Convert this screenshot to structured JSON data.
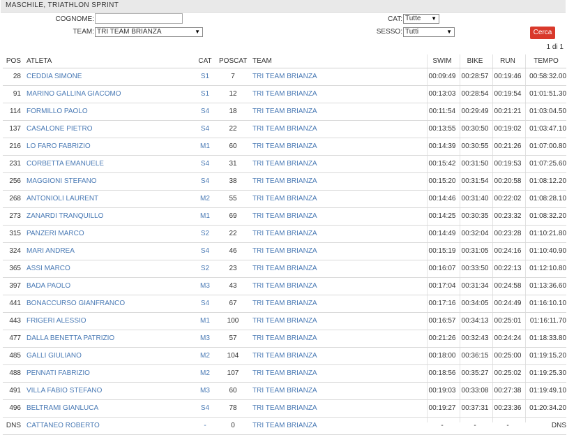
{
  "title": "MASCHILE, TRIATHLON SPRINT",
  "filters": {
    "cognome_label": "COGNOME:",
    "cognome_value": "",
    "team_label": "TEAM:",
    "team_value": "TRI TEAM BRIANZA",
    "cat_label": "CAT:",
    "cat_value": "Tutte",
    "sesso_label": "SESSO:",
    "sesso_value": "Tutti",
    "search_button": "Cerca"
  },
  "pager": "1 di 1",
  "columns": {
    "pos": "POS",
    "atleta": "ATLETA",
    "cat": "CAT",
    "poscat": "POSCAT",
    "team": "TEAM",
    "swim": "SWIM",
    "bike": "BIKE",
    "run": "RUN",
    "tempo": "TEMPO"
  },
  "rows": [
    {
      "pos": "28",
      "atleta": "CEDDIA SIMONE",
      "cat": "S1",
      "poscat": "7",
      "team": "TRI TEAM BRIANZA",
      "swim": "00:09:49",
      "bike": "00:28:57",
      "run": "00:19:46",
      "tempo": "00:58:32.00"
    },
    {
      "pos": "91",
      "atleta": "MARINO GALLINA GIACOMO",
      "cat": "S1",
      "poscat": "12",
      "team": "TRI TEAM BRIANZA",
      "swim": "00:13:03",
      "bike": "00:28:54",
      "run": "00:19:54",
      "tempo": "01:01:51.30"
    },
    {
      "pos": "114",
      "atleta": "FORMILLO PAOLO",
      "cat": "S4",
      "poscat": "18",
      "team": "TRI TEAM BRIANZA",
      "swim": "00:11:54",
      "bike": "00:29:49",
      "run": "00:21:21",
      "tempo": "01:03:04.50"
    },
    {
      "pos": "137",
      "atleta": "CASALONE PIETRO",
      "cat": "S4",
      "poscat": "22",
      "team": "TRI TEAM BRIANZA",
      "swim": "00:13:55",
      "bike": "00:30:50",
      "run": "00:19:02",
      "tempo": "01:03:47.10"
    },
    {
      "pos": "216",
      "atleta": "LO FARO FABRIZIO",
      "cat": "M1",
      "poscat": "60",
      "team": "TRI TEAM BRIANZA",
      "swim": "00:14:39",
      "bike": "00:30:55",
      "run": "00:21:26",
      "tempo": "01:07:00.80"
    },
    {
      "pos": "231",
      "atleta": "CORBETTA EMANUELE",
      "cat": "S4",
      "poscat": "31",
      "team": "TRI TEAM BRIANZA",
      "swim": "00:15:42",
      "bike": "00:31:50",
      "run": "00:19:53",
      "tempo": "01:07:25.60"
    },
    {
      "pos": "256",
      "atleta": "MAGGIONI STEFANO",
      "cat": "S4",
      "poscat": "38",
      "team": "TRI TEAM BRIANZA",
      "swim": "00:15:20",
      "bike": "00:31:54",
      "run": "00:20:58",
      "tempo": "01:08:12.20"
    },
    {
      "pos": "268",
      "atleta": "ANTONIOLI LAURENT",
      "cat": "M2",
      "poscat": "55",
      "team": "TRI TEAM BRIANZA",
      "swim": "00:14:46",
      "bike": "00:31:40",
      "run": "00:22:02",
      "tempo": "01:08:28.10"
    },
    {
      "pos": "273",
      "atleta": "ZANARDI TRANQUILLO",
      "cat": "M1",
      "poscat": "69",
      "team": "TRI TEAM BRIANZA",
      "swim": "00:14:25",
      "bike": "00:30:35",
      "run": "00:23:32",
      "tempo": "01:08:32.20"
    },
    {
      "pos": "315",
      "atleta": "PANZERI MARCO",
      "cat": "S2",
      "poscat": "22",
      "team": "TRI TEAM BRIANZA",
      "swim": "00:14:49",
      "bike": "00:32:04",
      "run": "00:23:28",
      "tempo": "01:10:21.80"
    },
    {
      "pos": "324",
      "atleta": "MARI ANDREA",
      "cat": "S4",
      "poscat": "46",
      "team": "TRI TEAM BRIANZA",
      "swim": "00:15:19",
      "bike": "00:31:05",
      "run": "00:24:16",
      "tempo": "01:10:40.90"
    },
    {
      "pos": "365",
      "atleta": "ASSI MARCO",
      "cat": "S2",
      "poscat": "23",
      "team": "TRI TEAM BRIANZA",
      "swim": "00:16:07",
      "bike": "00:33:50",
      "run": "00:22:13",
      "tempo": "01:12:10.80"
    },
    {
      "pos": "397",
      "atleta": "BADA PAOLO",
      "cat": "M3",
      "poscat": "43",
      "team": "TRI TEAM BRIANZA",
      "swim": "00:17:04",
      "bike": "00:31:34",
      "run": "00:24:58",
      "tempo": "01:13:36.60"
    },
    {
      "pos": "441",
      "atleta": "BONACCURSO GIANFRANCO",
      "cat": "S4",
      "poscat": "67",
      "team": "TRI TEAM BRIANZA",
      "swim": "00:17:16",
      "bike": "00:34:05",
      "run": "00:24:49",
      "tempo": "01:16:10.10"
    },
    {
      "pos": "443",
      "atleta": "FRIGERI ALESSIO",
      "cat": "M1",
      "poscat": "100",
      "team": "TRI TEAM BRIANZA",
      "swim": "00:16:57",
      "bike": "00:34:13",
      "run": "00:25:01",
      "tempo": "01:16:11.70"
    },
    {
      "pos": "477",
      "atleta": "DALLA BENETTA PATRIZIO",
      "cat": "M3",
      "poscat": "57",
      "team": "TRI TEAM BRIANZA",
      "swim": "00:21:26",
      "bike": "00:32:43",
      "run": "00:24:24",
      "tempo": "01:18:33.80"
    },
    {
      "pos": "485",
      "atleta": "GALLI GIULIANO",
      "cat": "M2",
      "poscat": "104",
      "team": "TRI TEAM BRIANZA",
      "swim": "00:18:00",
      "bike": "00:36:15",
      "run": "00:25:00",
      "tempo": "01:19:15.20"
    },
    {
      "pos": "488",
      "atleta": "PENNATI FABRIZIO",
      "cat": "M2",
      "poscat": "107",
      "team": "TRI TEAM BRIANZA",
      "swim": "00:18:56",
      "bike": "00:35:27",
      "run": "00:25:02",
      "tempo": "01:19:25.30"
    },
    {
      "pos": "491",
      "atleta": "VILLA FABIO STEFANO",
      "cat": "M3",
      "poscat": "60",
      "team": "TRI TEAM BRIANZA",
      "swim": "00:19:03",
      "bike": "00:33:08",
      "run": "00:27:38",
      "tempo": "01:19:49.10"
    },
    {
      "pos": "496",
      "atleta": "BELTRAMI GIANLUCA",
      "cat": "S4",
      "poscat": "78",
      "team": "TRI TEAM BRIANZA",
      "swim": "00:19:27",
      "bike": "00:37:31",
      "run": "00:23:36",
      "tempo": "01:20:34.20"
    },
    {
      "pos": "DNS",
      "atleta": "CATTANEO ROBERTO",
      "cat": "-",
      "poscat": "0",
      "team": "TRI TEAM BRIANZA",
      "swim": "-",
      "bike": "-",
      "run": "-",
      "tempo": "DNS"
    }
  ],
  "colors": {
    "link": "#4a7ab5",
    "button": "#d9392b",
    "header_bg": "#e9e9e9"
  }
}
